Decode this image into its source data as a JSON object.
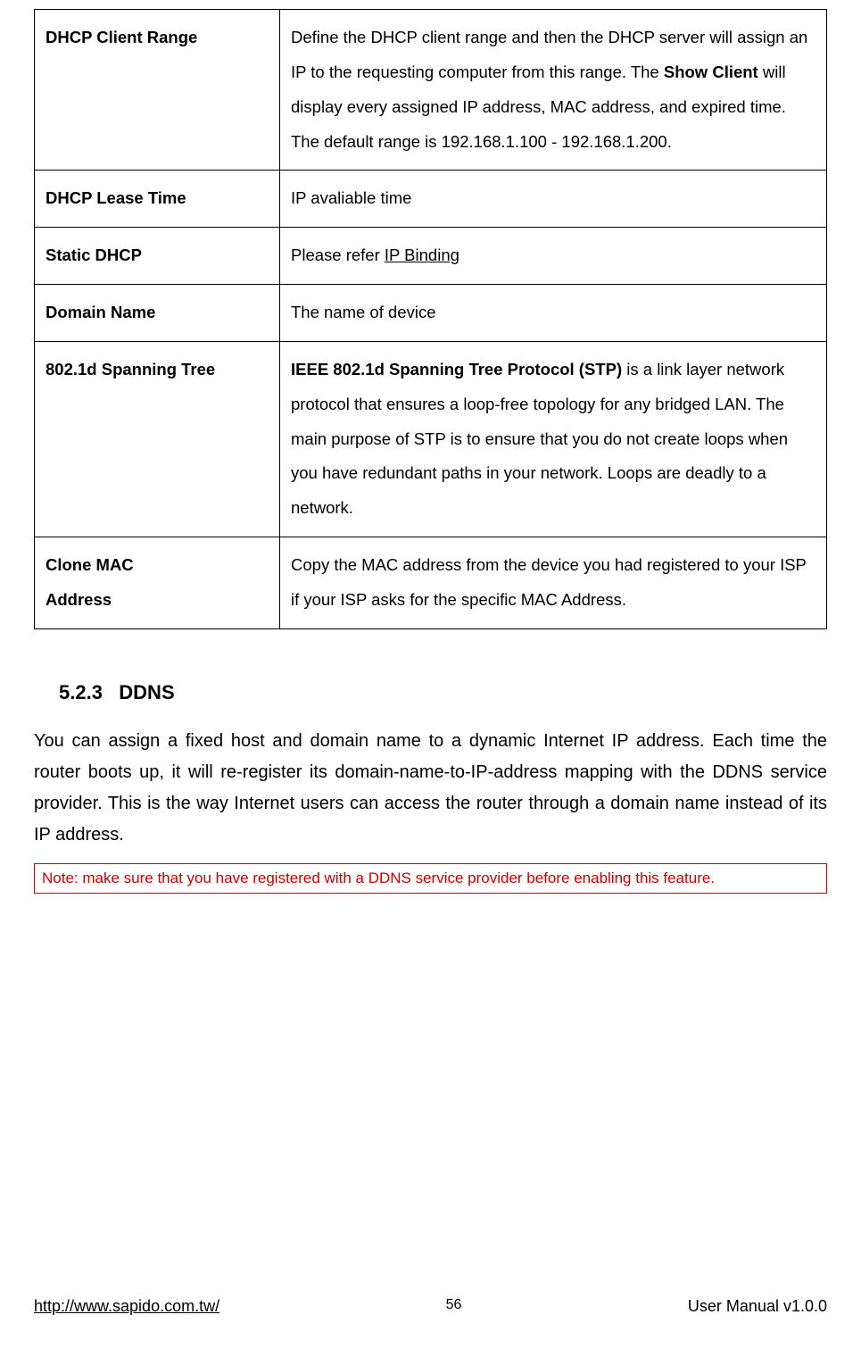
{
  "table": {
    "rows": [
      {
        "label": "DHCP Client Range",
        "desc_pre": "Define the DHCP client range and then the DHCP server will assign an IP to the requesting computer from this range. The ",
        "desc_bold": "Show Client",
        "desc_post": " will display every assigned IP address, MAC address, and expired time. The default range is 192.168.1.100 - 192.168.1.200.",
        "justify": true
      },
      {
        "label": "DHCP Lease Time",
        "desc": "IP avaliable time"
      },
      {
        "label": "Static DHCP",
        "desc_pre": "Please refer ",
        "link": "IP Binding"
      },
      {
        "label": "Domain Name",
        "desc": "The name of device"
      },
      {
        "label": "802.1d Spanning Tree",
        "desc_bold": "IEEE 802.1d Spanning Tree Protocol (STP)",
        "desc_post": " is a link layer network protocol that ensures a loop-free topology for any bridged LAN. The main purpose of STP is to ensure that you do not create loops when you have redundant paths in your network. Loops are deadly to a network.",
        "justify": true
      },
      {
        "label_line1": "Clone MAC",
        "label_line2": "Address",
        "desc": "Copy the MAC address from the device you had registered to your ISP if your ISP asks for the specific MAC Address.",
        "justify": true
      }
    ]
  },
  "section": {
    "number": "5.2.3",
    "title": "DDNS",
    "body": "You can assign a fixed host and domain name to a dynamic Internet IP address. Each time the router boots up, it will re-register its domain-name-to-IP-address mapping with the DDNS service provider. This is the way Internet users can access the router through a domain name instead of its IP address.",
    "note": "Note: make sure that you have registered with a DDNS service provider before enabling this feature."
  },
  "footer": {
    "url": "http://www.sapido.com.tw/",
    "page": "56",
    "right": "User Manual v1.0.0"
  }
}
